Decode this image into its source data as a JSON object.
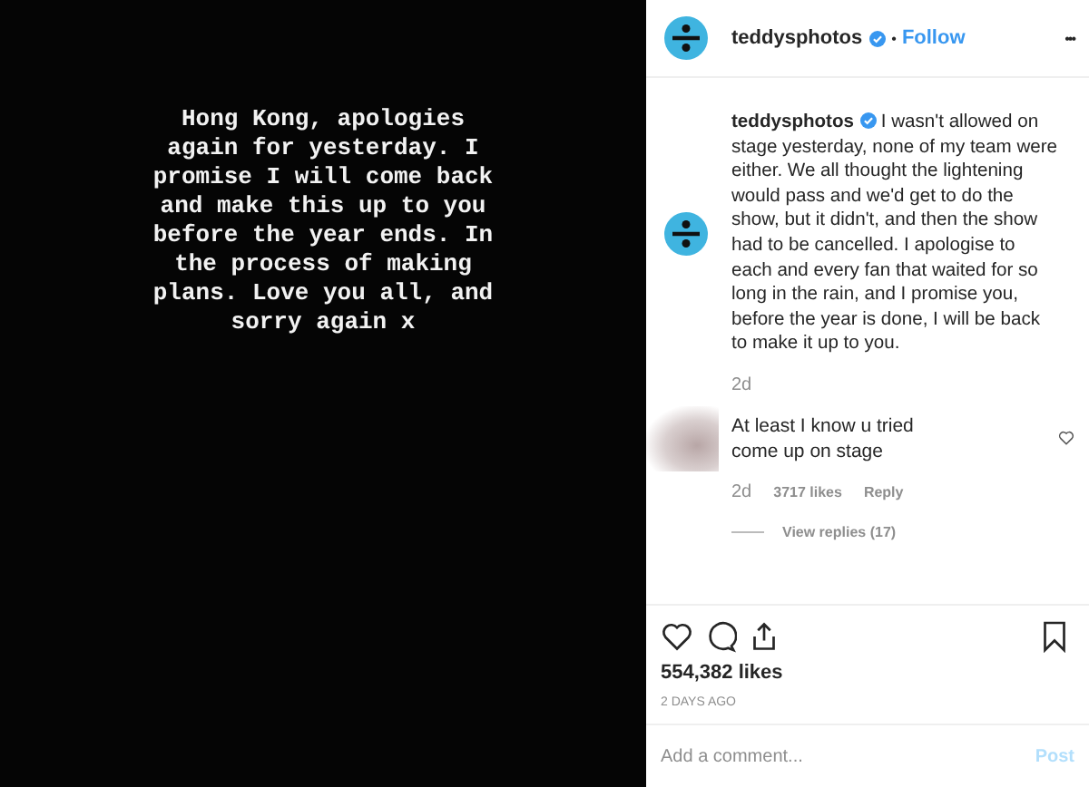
{
  "post_image": {
    "text": "Hong Kong, apologies\nagain for yesterday. I\npromise I will come back\nand make this up to you\nbefore the year ends. In\nthe process of making\nplans. Love you all, and\nsorry again x"
  },
  "header": {
    "username": "teddysphotos",
    "verified": true,
    "separator": "•",
    "follow": "Follow",
    "more": "•••"
  },
  "caption": {
    "username": "teddysphotos",
    "verified": true,
    "text": "I wasn't allowed on stage yesterday, none of my team were either. We all thought the lightening would pass and we'd get to do the show, but it didn't, and then the show had to be cancelled. I apologise to each and every fan that waited for so long in the rain, and I promise you, before the year is done, I will be back to make it up to you.",
    "time": "2d"
  },
  "comments": [
    {
      "lines": [
        "At least I know u tried",
        "come up on stage"
      ],
      "time": "2d",
      "likes": "3717 likes",
      "reply": "Reply",
      "liked": false,
      "view_replies": "View replies (17)"
    }
  ],
  "actions": {
    "liked": false,
    "saved": false
  },
  "likes": "554,382 likes",
  "date": "2 DAYS AGO",
  "comment_box": {
    "placeholder": "Add a comment...",
    "post": "Post"
  }
}
